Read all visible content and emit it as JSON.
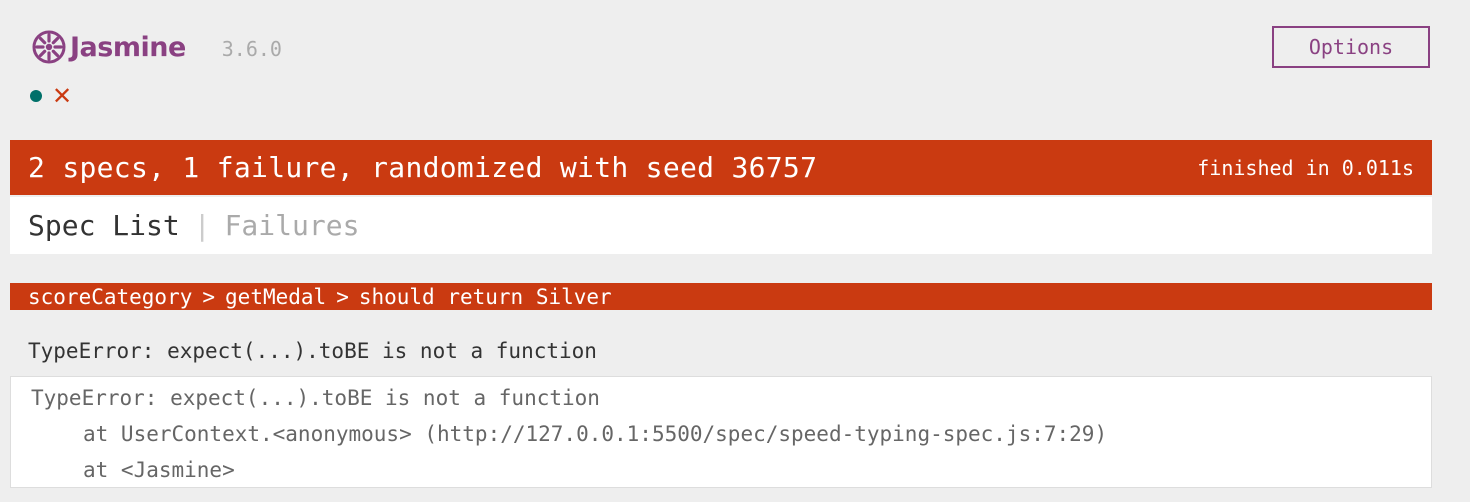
{
  "banner": {
    "brand": "Jasmine",
    "version": "3.6.0",
    "options_label": "Options"
  },
  "symbols": [
    {
      "status": "passed",
      "icon": "dot-icon",
      "color": "#007069"
    },
    {
      "status": "failed",
      "glyph": "✕",
      "icon": "cross-icon",
      "color": "#ca3a11"
    }
  ],
  "alert": {
    "summary": "2 specs, 1 failure, randomized with seed 36757",
    "duration": "finished in 0.011s",
    "color": "#ca3a11"
  },
  "menu": {
    "spec_list": "Spec List",
    "separator": "|",
    "failures": "Failures"
  },
  "failure": {
    "path": [
      "scoreCategory",
      "getMedal",
      "should return Silver"
    ],
    "separator": ">",
    "message": "TypeError: expect(...).toBE is not a function",
    "stack": [
      "TypeError: expect(...).toBE is not a function",
      "at UserContext.<anonymous> (http://127.0.0.1:5500/spec/speed-typing-spec.js:7:29)",
      "at <Jasmine>"
    ]
  },
  "colors": {
    "brand": "#8a4182",
    "fail": "#ca3a11",
    "pass": "#007069"
  }
}
